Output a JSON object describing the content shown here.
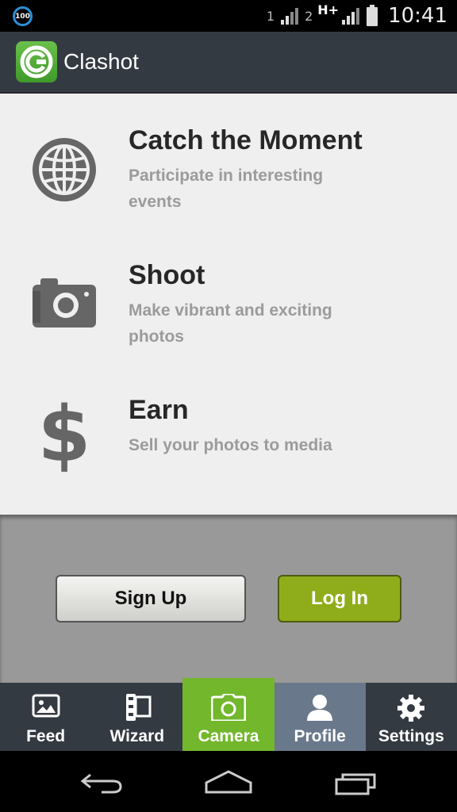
{
  "status_bar": {
    "battery_level": "100",
    "sim1_label": "1",
    "sim2_label": "2",
    "network_type": "H+",
    "time": "10:41"
  },
  "app_bar": {
    "title": "Clashot",
    "logo_icon": "clashot-logo-icon"
  },
  "features": [
    {
      "icon": "globe-icon",
      "title": "Catch the Moment",
      "description": "Participate in interesting events"
    },
    {
      "icon": "camera-icon",
      "title": "Shoot",
      "description": "Make vibrant and exciting photos"
    },
    {
      "icon": "dollar-icon",
      "title": "Earn",
      "description": "Sell your photos to media"
    }
  ],
  "auth": {
    "signup_label": "Sign Up",
    "login_label": "Log In"
  },
  "tabs": [
    {
      "label": "Feed",
      "icon": "image-icon",
      "selected": false
    },
    {
      "label": "Wizard",
      "icon": "film-icon",
      "selected": false
    },
    {
      "label": "Camera",
      "icon": "camera-icon",
      "selected": true
    },
    {
      "label": "Profile",
      "icon": "person-icon",
      "selected": false
    },
    {
      "label": "Settings",
      "icon": "gear-icon",
      "selected": false
    }
  ],
  "colors": {
    "accent_green": "#72b72c",
    "login_green": "#8fad1a",
    "profile_tab": "#6a788b",
    "bar_dark": "#343a42"
  }
}
